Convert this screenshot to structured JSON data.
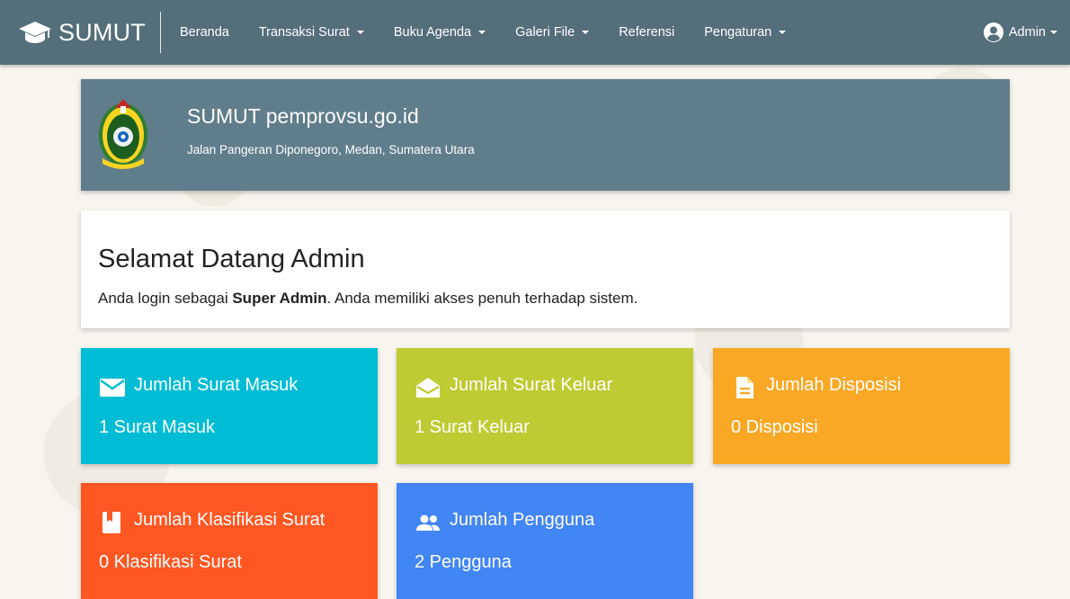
{
  "navbar": {
    "brand": "SUMUT",
    "items": [
      {
        "label": "Beranda",
        "dropdown": false
      },
      {
        "label": "Transaksi Surat",
        "dropdown": true
      },
      {
        "label": "Buku Agenda",
        "dropdown": true
      },
      {
        "label": "Galeri File",
        "dropdown": true
      },
      {
        "label": "Referensi",
        "dropdown": false
      },
      {
        "label": "Pengaturan",
        "dropdown": true
      }
    ],
    "user": "Admin",
    "background": "#546e7a"
  },
  "header": {
    "title": "SUMUT pemprovsu.go.id",
    "address": "Jalan Pangeran Diponegoro, Medan, Sumatera Utara",
    "background": "#607d8b"
  },
  "welcome": {
    "title": "Selamat Datang Admin",
    "text_prefix": "Anda login sebagai ",
    "role": "Super Admin",
    "text_suffix": ". Anda memiliki akses penuh terhadap sistem."
  },
  "stats": [
    {
      "label": "Jumlah Surat Masuk",
      "value": "1 Surat Masuk",
      "color": "#00bcd4",
      "icon": "envelope-icon"
    },
    {
      "label": "Jumlah Surat Keluar",
      "value": "1 Surat Keluar",
      "color": "#c0ca33",
      "icon": "envelope-open-icon"
    },
    {
      "label": "Jumlah Disposisi",
      "value": "0 Disposisi",
      "color": "#f9a825",
      "icon": "document-icon"
    },
    {
      "label": "Jumlah Klasifikasi Surat",
      "value": "0 Klasifikasi Surat",
      "color": "#ff5722",
      "icon": "bookmark-icon"
    },
    {
      "label": "Jumlah Pengguna",
      "value": "2 Pengguna",
      "color": "#4285f4",
      "icon": "people-icon"
    }
  ]
}
